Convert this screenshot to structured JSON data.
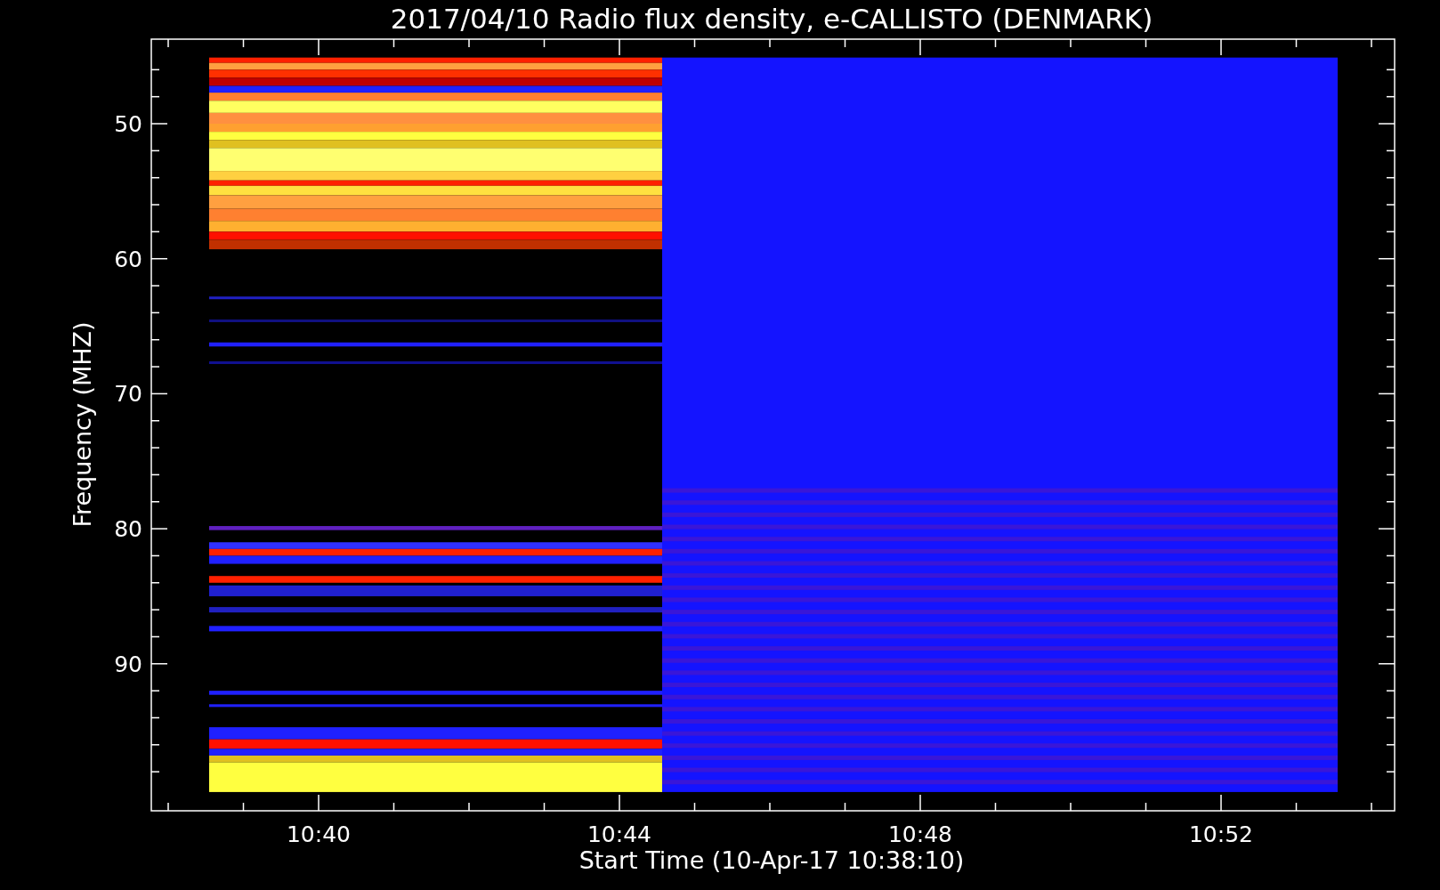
{
  "title": "2017/04/10  Radio flux density, e-CALLISTO (DENMARK)",
  "plot": {
    "ylabel": "Frequency (MHZ)",
    "xlabel": "Start Time (10-Apr-17 10:38:10)",
    "yticks": [
      "50",
      "60",
      "70",
      "80",
      "90"
    ],
    "xticks": [
      "10:40",
      "10:44",
      "10:48",
      "10:52"
    ]
  }
}
